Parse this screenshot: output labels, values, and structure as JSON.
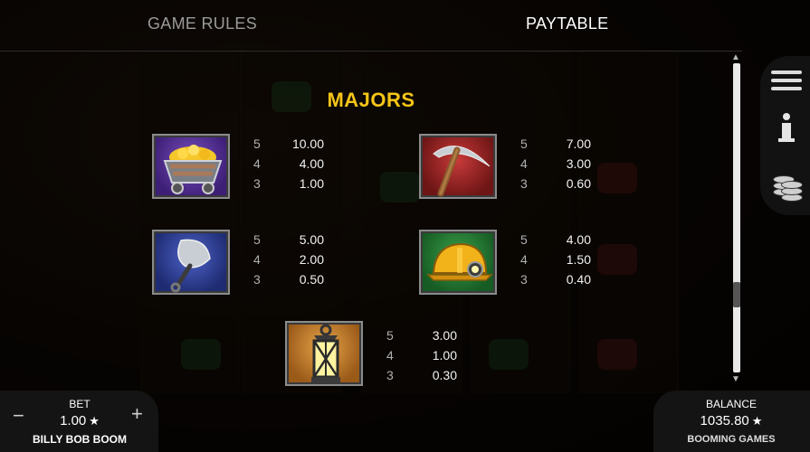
{
  "tabs": {
    "rules": "GAME RULES",
    "paytable": "PAYTABLE"
  },
  "section_title": "MAJORS",
  "symbols": {
    "cart": {
      "icon": "gold-cart-icon",
      "pays": [
        {
          "count": "5",
          "value": "10.00"
        },
        {
          "count": "4",
          "value": "4.00"
        },
        {
          "count": "3",
          "value": "1.00"
        }
      ]
    },
    "pickaxe": {
      "icon": "pickaxe-icon",
      "pays": [
        {
          "count": "5",
          "value": "7.00"
        },
        {
          "count": "4",
          "value": "3.00"
        },
        {
          "count": "3",
          "value": "0.60"
        }
      ]
    },
    "shovel": {
      "icon": "shovel-icon",
      "pays": [
        {
          "count": "5",
          "value": "5.00"
        },
        {
          "count": "4",
          "value": "2.00"
        },
        {
          "count": "3",
          "value": "0.50"
        }
      ]
    },
    "helmet": {
      "icon": "miner-helmet-icon",
      "pays": [
        {
          "count": "5",
          "value": "4.00"
        },
        {
          "count": "4",
          "value": "1.50"
        },
        {
          "count": "3",
          "value": "0.40"
        }
      ]
    },
    "lantern": {
      "icon": "lantern-icon",
      "pays": [
        {
          "count": "5",
          "value": "3.00"
        },
        {
          "count": "4",
          "value": "1.00"
        },
        {
          "count": "3",
          "value": "0.30"
        }
      ]
    }
  },
  "footer": {
    "bet_label": "BET",
    "bet_value": "1.00",
    "game_name": "BILLY BOB BOOM",
    "balance_label": "BALANCE",
    "balance_value": "1035.80",
    "brand": "BOOMING GAMES",
    "minus": "−",
    "plus": "+",
    "star": "★"
  },
  "colors": {
    "title": "#f5c518",
    "panel": "#141414"
  }
}
